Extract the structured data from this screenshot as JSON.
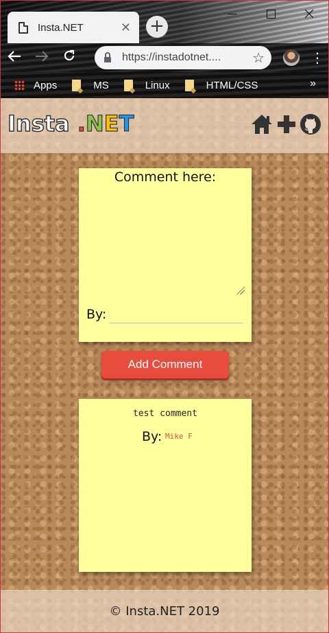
{
  "browser": {
    "tab_title": "Insta.NET",
    "tab_close": "✕",
    "new_tab": "+",
    "url": "https://instadotnet....",
    "bookmarks": [
      {
        "label": "Apps",
        "icon": "apps-grid-icon"
      },
      {
        "label": "MS",
        "icon": "folder-icon"
      },
      {
        "label": "Linux",
        "icon": "folder-icon"
      },
      {
        "label": "HTML/CSS",
        "icon": "folder-icon"
      }
    ],
    "bookmarks_more": "»"
  },
  "header": {
    "logo_part1": "Insta ",
    "logo_part2": [
      ".",
      "N",
      "E",
      "T"
    ],
    "icons": [
      "home-icon",
      "plus-icon",
      "github-icon"
    ]
  },
  "form": {
    "comment_label": "Comment here:",
    "comment_value": "",
    "by_label": "By:",
    "by_value": "",
    "submit_label": "Add Comment"
  },
  "comments": [
    {
      "text": "test comment",
      "by_label": "By:",
      "author": "Mike F"
    }
  ],
  "footer": {
    "text": "© Insta.NET 2019"
  },
  "colors": {
    "note": "#ffff9d",
    "button": "#e74c3c",
    "author": "#e74c3c"
  }
}
